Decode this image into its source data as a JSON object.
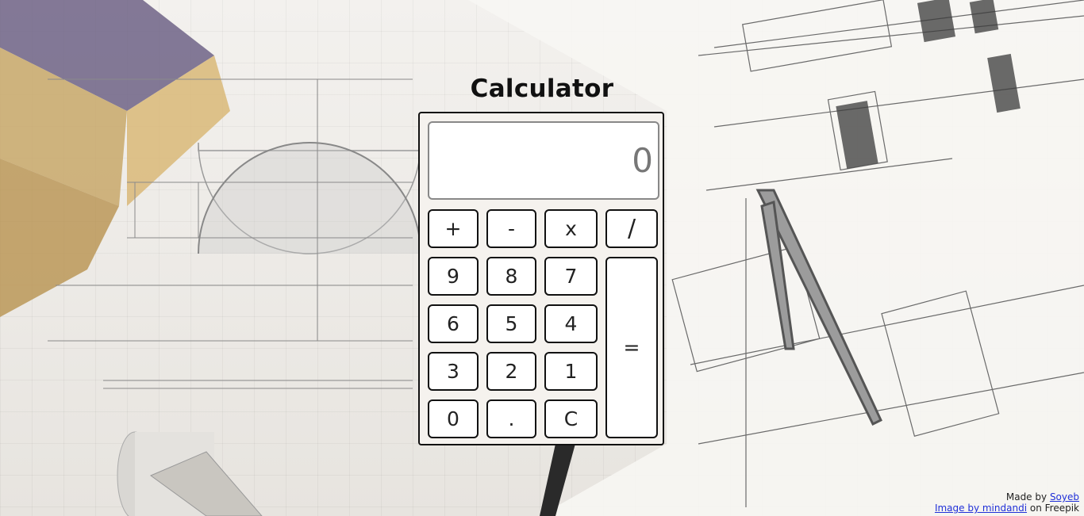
{
  "page": {
    "title": "Calculator"
  },
  "display": {
    "value": "0"
  },
  "operators": {
    "plus": "+",
    "minus": "-",
    "multiply": "x",
    "divide": "/"
  },
  "digits": {
    "nine": "9",
    "eight": "8",
    "seven": "7",
    "six": "6",
    "five": "5",
    "four": "4",
    "three": "3",
    "two": "2",
    "one": "1",
    "zero": "0",
    "dot": ".",
    "clear": "C",
    "equals": "="
  },
  "footer": {
    "made_by_prefix": "Made by",
    "made_by_link": "Soyeb",
    "image_link": "Image by mindandi",
    "image_suffix": "on Freepik"
  }
}
